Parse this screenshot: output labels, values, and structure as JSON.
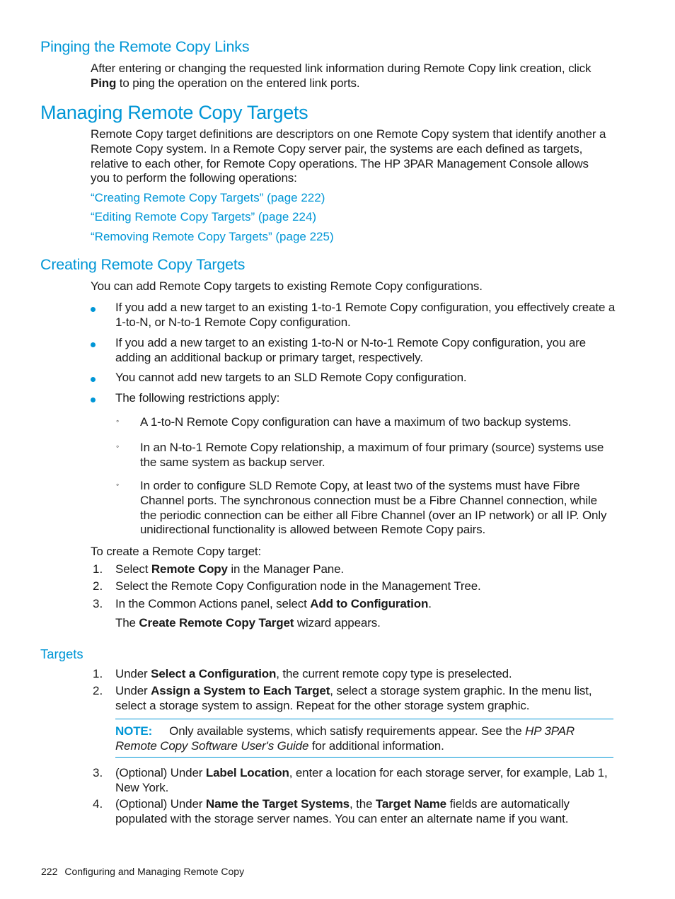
{
  "sections": {
    "pinging": {
      "heading": "Pinging the Remote Copy Links",
      "para_pre": "After entering or changing the requested link information during Remote Copy link creation, click ",
      "para_bold": "Ping",
      "para_post": " to ping the operation on the entered link ports."
    },
    "managing": {
      "heading": "Managing Remote Copy Targets",
      "para": "Remote Copy target definitions are descriptors on one Remote Copy system that identify another a Remote Copy system. In a Remote Copy server pair, the systems are each defined as targets, relative to each other, for Remote Copy operations. The HP 3PAR Management Console allows you to perform the following operations:",
      "links": [
        "“Creating Remote Copy Targets” (page 222)",
        "“Editing Remote Copy Targets” (page 224)",
        "“Removing Remote Copy Targets” (page 225)"
      ]
    },
    "creating": {
      "heading": "Creating Remote Copy Targets",
      "intro": "You can add Remote Copy targets to existing Remote Copy configurations.",
      "bullets": [
        "If you add a new target to an existing 1-to-1 Remote Copy configuration, you effectively create a 1-to-N, or N-to-1 Remote Copy configuration.",
        "If you add a new target to an existing 1-to-N or N-to-1 Remote Copy configuration, you are adding an additional backup or primary target, respectively.",
        "You cannot add new targets to an SLD Remote Copy configuration.",
        "The following restrictions apply:"
      ],
      "sub_bullets": [
        "A 1-to-N Remote Copy configuration can have a maximum of two backup systems.",
        "In an N-to-1 Remote Copy relationship, a maximum of four primary (source) systems use the same system as backup server.",
        "In order to configure SLD Remote Copy, at least two of the systems must have Fibre Channel ports. The synchronous connection must be a Fibre Channel connection, while the periodic connection can be either all Fibre Channel (over an IP network) or all IP. Only unidirectional functionality is allowed between Remote Copy pairs."
      ],
      "steps_intro": "To create a Remote Copy target:",
      "steps": [
        {
          "num": "1.",
          "pre": "Select ",
          "bold": "Remote Copy",
          "post": " in the Manager Pane."
        },
        {
          "num": "2.",
          "pre": "Select the Remote Copy Configuration node in the Management Tree.",
          "bold": "",
          "post": ""
        },
        {
          "num": "3.",
          "pre": "In the Common Actions panel, select ",
          "bold": "Add to Configuration",
          "post": "."
        }
      ],
      "step_result_pre": "The ",
      "step_result_bold": "Create Remote Copy Target",
      "step_result_post": " wizard appears."
    },
    "targets": {
      "heading": "Targets",
      "steps": [
        {
          "num": "1.",
          "pre": "Under ",
          "bold": "Select a Configuration",
          "post": ", the current remote copy type is preselected."
        },
        {
          "num": "2.",
          "pre": "Under ",
          "bold": "Assign a System to Each Target",
          "post": ", select a storage system graphic. In the menu list, select a storage system to assign. Repeat for the other storage system graphic."
        }
      ],
      "note": {
        "label": "NOTE:",
        "text_pre": "Only available systems, which satisfy requirements appear. See the ",
        "text_italic": "HP 3PAR Remote Copy Software User's Guide",
        "text_post": " for additional information."
      },
      "steps2": [
        {
          "num": "3.",
          "pre": "(Optional) Under ",
          "bold": "Label Location",
          "post": ", enter a location for each storage server, for example, Lab 1, New York."
        },
        {
          "num": "4.",
          "pre": "(Optional) Under ",
          "bold": "Name the Target Systems",
          "mid": ", the ",
          "bold2": "Target Name",
          "post": " fields are automatically populated with the storage server names. You can enter an alternate name if you want."
        }
      ]
    }
  },
  "footer": {
    "page_number": "222",
    "chapter": "Configuring and Managing Remote Copy"
  },
  "colors": {
    "accent": "#0096d6",
    "text": "#1a1a1a"
  }
}
